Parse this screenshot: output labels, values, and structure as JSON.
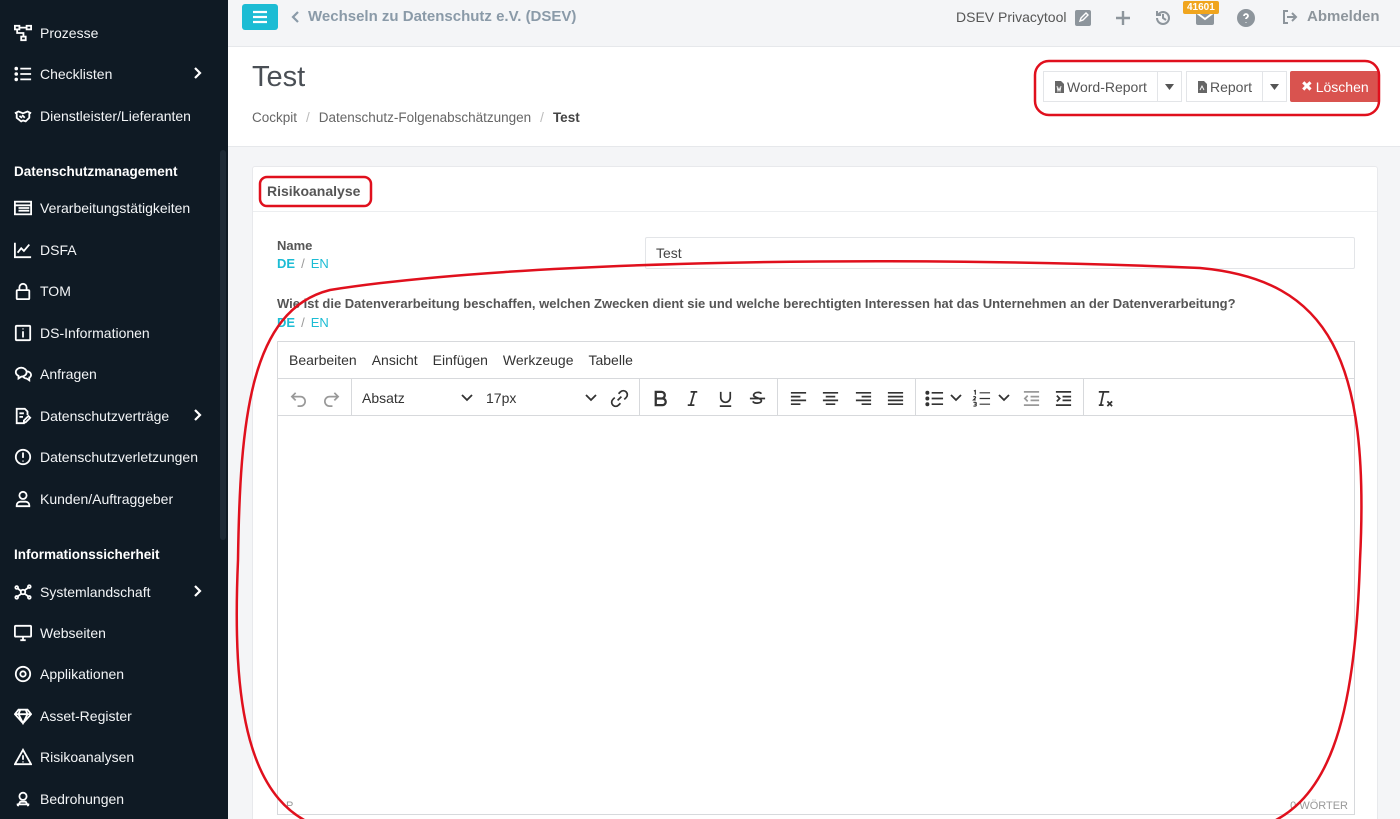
{
  "sidebar": {
    "items_top": [
      {
        "label": "Prozesse",
        "icon": "process-icon"
      },
      {
        "label": "Checklisten",
        "icon": "list-icon",
        "has_children": true
      },
      {
        "label": "Dienstleister/Lieferanten",
        "icon": "handshake-icon"
      }
    ],
    "section1": "Datenschutzmanagement",
    "items_ds": [
      {
        "label": "Verarbeitungstätigkeiten",
        "icon": "table-list-icon"
      },
      {
        "label": "DSFA",
        "icon": "chart-line-icon"
      },
      {
        "label": "TOM",
        "icon": "lock-icon"
      },
      {
        "label": "DS-Informationen",
        "icon": "info-icon"
      },
      {
        "label": "Anfragen",
        "icon": "chat-icon"
      },
      {
        "label": "Datenschutzverträge",
        "icon": "contract-icon",
        "has_children": true
      },
      {
        "label": "Datenschutzverletzungen",
        "icon": "alert-circle-icon"
      },
      {
        "label": "Kunden/Auftraggeber",
        "icon": "user-icon"
      }
    ],
    "section2": "Informationssicherheit",
    "items_is": [
      {
        "label": "Systemlandschaft",
        "icon": "network-icon",
        "has_children": true
      },
      {
        "label": "Webseiten",
        "icon": "monitor-icon"
      },
      {
        "label": "Applikationen",
        "icon": "app-icon"
      },
      {
        "label": "Asset-Register",
        "icon": "diamond-icon"
      },
      {
        "label": "Risikoanalysen",
        "icon": "warning-icon"
      },
      {
        "label": "Bedrohungen",
        "icon": "threat-icon"
      }
    ]
  },
  "topbar": {
    "back_label": "Wechseln zu Datenschutz e.V. (DSEV)",
    "tool_title": "DSEV Privacytool",
    "notification_count": "41601",
    "logout_label": "Abmelden"
  },
  "header": {
    "title": "Test",
    "breadcrumb": [
      "Cockpit",
      "Datenschutz-Folgenabschätzungen",
      "Test"
    ],
    "word_report_label": "Word-Report",
    "report_label": "Report",
    "delete_label": "Löschen"
  },
  "card": {
    "title": "Risikoanalyse",
    "name_label": "Name",
    "lang_de": "DE",
    "lang_en": "EN",
    "name_value": "Test",
    "question": "Wie ist die Datenverarbeitung beschaffen, welchen Zwecken dient sie und welche berechtigten Interessen hat das Unternehmen an der Datenverarbeitung?"
  },
  "editor": {
    "menu": [
      "Bearbeiten",
      "Ansicht",
      "Einfügen",
      "Werkzeuge",
      "Tabelle"
    ],
    "block_format": "Absatz",
    "font_size": "17px",
    "status_path": "P",
    "word_count": "0 WÖRTER"
  },
  "colors": {
    "sidebar_bg": "#0f1a24",
    "accent": "#1cbcd4",
    "danger": "#d9534f",
    "badge": "#f0a51e",
    "annotation": "#e0101d"
  }
}
